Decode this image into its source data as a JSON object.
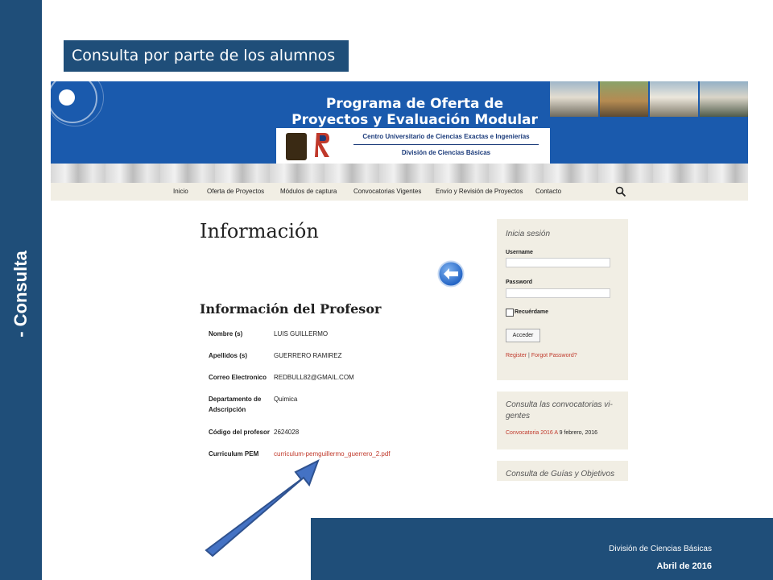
{
  "slide": {
    "side_label": "- Consulta",
    "title": "Consulta por parte de los alumnos",
    "footer_org": "División de Ciencias Básicas",
    "footer_date": "Abril de 2016"
  },
  "site": {
    "banner_title": "Programa de Oferta de Proyectos y Evaluación Modular",
    "org_line1": "Centro Universitario de Ciencias Exactas e Ingenierías",
    "org_line2": "División de Ciencias Básicas",
    "nav": [
      "Inicio",
      "Oferta de Proyectos",
      "Módulos de captura",
      "Convocatorias Vigentes",
      "Envío y Revisión de Proyectos",
      "Contacto"
    ]
  },
  "content": {
    "page_title": "Información",
    "section_title": "Información del Profesor",
    "fields": [
      {
        "label": "Nombre (s)",
        "value": "LUIS GUILLERMO"
      },
      {
        "label": "Apellidos (s)",
        "value": "GUERRERO RAMIREZ"
      },
      {
        "label": "Correo Electronico",
        "value": "REDBULL82@GMAIL.COM"
      },
      {
        "label": "Departamento de Adscripción",
        "value": "Quimica"
      },
      {
        "label": "Código del profesor",
        "value": "2624028"
      },
      {
        "label": "Curriculum PEM",
        "value": "curriculum-pemguillermo_guerrero_2.pdf"
      }
    ]
  },
  "sidebar": {
    "login_title": "Inicia sesión",
    "username_label": "Username",
    "password_label": "Password",
    "remember_label": "Recuérdame",
    "submit_label": "Acceder",
    "register_link": "Register",
    "link_separator": "|",
    "forgot_link": "Forgot Password?",
    "conv_title": "Consulta las convocatorias vi-gentes",
    "conv_link": "Convocatoria 2016 A",
    "conv_date": "9 febrero, 2016",
    "guides_title": "Consulta de Guías y Objetivos"
  },
  "colors": {
    "slide_blue": "#1f4e79",
    "banner_blue": "#1a5aad",
    "link_red": "#c0392b",
    "arrow_blue": "#4472c4"
  },
  "icons": {
    "back": "left-arrow-circle-icon",
    "search": "search-icon",
    "pointer": "pointer-arrow-icon"
  }
}
